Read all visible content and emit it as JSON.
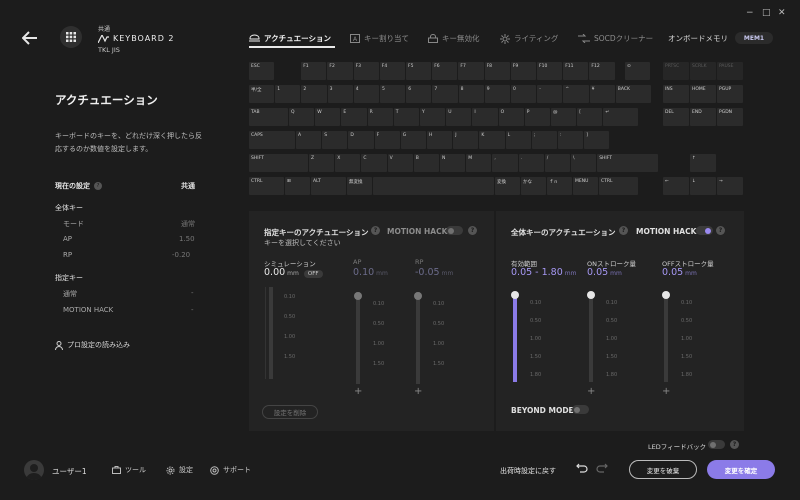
{
  "window": {
    "minimize": "−",
    "maximize": "□",
    "close": "✕"
  },
  "device": {
    "label_top": "共通",
    "name": "KEYBOARD 2",
    "layout": "TKL JIS"
  },
  "tabs": [
    {
      "label": "アクチュエーション"
    },
    {
      "label": "キー割り当て"
    },
    {
      "label": "キー無効化"
    },
    {
      "label": "ライティング"
    },
    {
      "label": "SOCDクリーナー"
    },
    {
      "label": "オンボードメモリ"
    }
  ],
  "memory_badge": "MEM1",
  "sidebar": {
    "title": "アクチュエーション",
    "description": "キーボードのキーを、どれだけ深く押したら反応するのか数値を設定します。",
    "current_label": "現在の設定",
    "current_value": "共通",
    "global_label": "全体キー",
    "global_rows": [
      {
        "label": "モード",
        "value": "通常"
      },
      {
        "label": "AP",
        "value": "1.50"
      },
      {
        "label": "RP",
        "value": "-0.20"
      }
    ],
    "specific_label": "指定キー",
    "specific_rows": [
      {
        "label": "通常",
        "value": "-"
      },
      {
        "label": "MOTION HACK",
        "value": "-"
      }
    ],
    "pro_settings": "プロ設定の読み込み"
  },
  "keyboard": {
    "row0": [
      "ESC",
      "F1",
      "F2",
      "F3",
      "F4",
      "F5",
      "F6",
      "F7",
      "F8",
      "F9",
      "F10",
      "F11",
      "F12",
      "⊙"
    ],
    "row0_nav": [
      "PRTSC",
      "SCRLK",
      "PAUSE"
    ],
    "row1": [
      "半/全",
      "1",
      "2",
      "3",
      "4",
      "5",
      "6",
      "7",
      "8",
      "9",
      "0",
      "-",
      "^",
      "¥",
      "BACK"
    ],
    "row1_nav": [
      "INS",
      "HOME",
      "PGUP"
    ],
    "row2": [
      "TAB",
      "Q",
      "W",
      "E",
      "R",
      "T",
      "Y",
      "U",
      "I",
      "O",
      "P",
      "@",
      "[",
      "↵"
    ],
    "row2_nav": [
      "DEL",
      "END",
      "PGDN"
    ],
    "row3": [
      "CAPS",
      "A",
      "S",
      "D",
      "F",
      "G",
      "H",
      "J",
      "K",
      "L",
      ";",
      ":",
      "]"
    ],
    "row4": [
      "SHIFT",
      "Z",
      "X",
      "C",
      "V",
      "B",
      "N",
      "M",
      ",",
      ".",
      "/",
      "\\",
      "SHIFT"
    ],
    "row4_nav": [
      "↑"
    ],
    "row5": [
      "CTRL",
      "⊞",
      "ALT",
      "無変換",
      "",
      "変換",
      "かな",
      "ｆｎ",
      "MENU",
      "CTRL"
    ],
    "row5_nav": [
      "←",
      "↓",
      "→"
    ]
  },
  "specific_panel": {
    "title": "指定キーのアクチュエーション",
    "motion_hack": "MOTION HACK",
    "subtitle": "キーを選択してください",
    "sim_label": "シミュレーション",
    "sim_value": "0.00",
    "sim_unit": "mm",
    "sim_badge": "OFF",
    "ap_label": "AP",
    "ap_value": "0.10",
    "ap_unit": "mm",
    "rp_label": "RP",
    "rp_value": "-0.05",
    "rp_unit": "mm",
    "delete_button": "設定を削除",
    "ticks": [
      "0.10",
      "0.50",
      "1.00",
      "1.50"
    ]
  },
  "global_panel": {
    "title": "全体キーのアクチュエーション",
    "motion_hack": "MOTION HACK",
    "range_label": "有効範囲",
    "range_value": "0.05 - 1.80",
    "range_unit": "mm",
    "on_label": "ONストローク量",
    "on_value": "0.05",
    "on_unit": "mm",
    "off_label": "OFFストローク量",
    "off_value": "0.05",
    "off_unit": "mm",
    "beyond_mode": "BEYOND MODE",
    "ticks": [
      "0.10",
      "0.50",
      "1.00",
      "1.50",
      "1.80"
    ],
    "range_fill_fraction": 1.0
  },
  "led_feedback": "LEDフィードバック",
  "footer": {
    "user": "ユーザー1",
    "tools": "ツール",
    "settings": "設定",
    "support": "サポート",
    "reset": "出荷時設定に戻す",
    "discard": "変更を破棄",
    "confirm": "変更を確定"
  },
  "colors": {
    "accent": "#8b7be8",
    "background": "#1c1c1c",
    "panel": "#232323"
  }
}
